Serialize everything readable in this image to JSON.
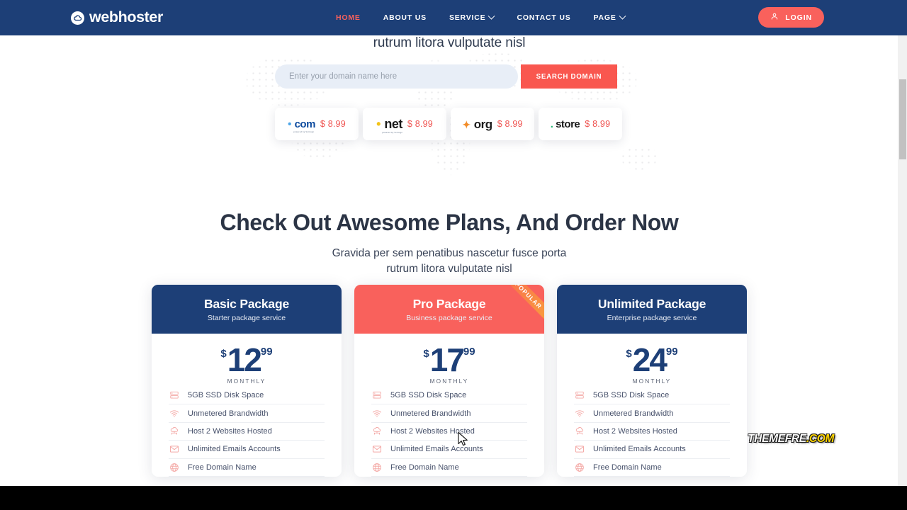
{
  "header": {
    "brand": "webhoster",
    "brand_icon": "cloud-icon",
    "nav": [
      {
        "label": "HOME",
        "active": true,
        "caret": false
      },
      {
        "label": "ABOUT US",
        "active": false,
        "caret": false
      },
      {
        "label": "SERVICE",
        "active": false,
        "caret": true
      },
      {
        "label": "CONTACT US",
        "active": false,
        "caret": false
      },
      {
        "label": "PAGE",
        "active": false,
        "caret": true
      }
    ],
    "login_label": "LOGIN",
    "login_icon": "user-icon",
    "bg_color": "#1d3f77",
    "accent_color": "#f9615c"
  },
  "hero": {
    "subtitle": "rutrum litora vulputate nisl",
    "search": {
      "placeholder": "Enter your domain name here",
      "value": "",
      "button_label": "SEARCH DOMAIN",
      "button_color": "#f9574f"
    },
    "tlds": [
      {
        "name": ".com",
        "logo_text": "com",
        "sub": "powered by Verisign",
        "price": "$ 8.99"
      },
      {
        "name": ".net",
        "logo_text": "net",
        "sub": "powered by Verisign",
        "price": "$ 8.99"
      },
      {
        "name": ".org",
        "logo_text": "org",
        "sub": "",
        "price": "$ 8.99"
      },
      {
        "name": ".store",
        "logo_text": "store",
        "sub": "",
        "price": "$ 8.99"
      }
    ]
  },
  "plans": {
    "title": "Check Out Awesome Plans, And Order Now",
    "subtitle": "Gravida per sem penatibus nascetur fusce porta\nrutrum litora vulputate nisl",
    "period_label": "MONTHLY",
    "currency": "$",
    "popular_label": "POPULAR",
    "cards": [
      {
        "name": "Basic Package",
        "tagline": "Starter package service",
        "theme": "navy",
        "popular": false,
        "amount": "12",
        "cents": "99",
        "features": [
          {
            "icon": "server-icon",
            "label": "5GB SSD Disk Space"
          },
          {
            "icon": "wifi-icon",
            "label": "Unmetered Brandwidth"
          },
          {
            "icon": "cloud-network-icon",
            "label": "Host 2 Websites Hosted"
          },
          {
            "icon": "envelope-icon",
            "label": "Unlimited Emails Accounts"
          },
          {
            "icon": "globe-icon",
            "label": "Free Domain Name"
          }
        ]
      },
      {
        "name": "Pro Package",
        "tagline": "Business package service",
        "theme": "coral",
        "popular": true,
        "amount": "17",
        "cents": "99",
        "features": [
          {
            "icon": "server-icon",
            "label": "5GB SSD Disk Space"
          },
          {
            "icon": "wifi-icon",
            "label": "Unmetered Brandwidth"
          },
          {
            "icon": "cloud-network-icon",
            "label": "Host 2 Websites Hosted"
          },
          {
            "icon": "envelope-icon",
            "label": "Unlimited Emails Accounts"
          },
          {
            "icon": "globe-icon",
            "label": "Free Domain Name"
          }
        ]
      },
      {
        "name": "Unlimited Package",
        "tagline": "Enterprise package service",
        "theme": "navy",
        "popular": false,
        "amount": "24",
        "cents": "99",
        "features": [
          {
            "icon": "server-icon",
            "label": "5GB SSD Disk Space"
          },
          {
            "icon": "wifi-icon",
            "label": "Unmetered Brandwidth"
          },
          {
            "icon": "cloud-network-icon",
            "label": "Host 2 Websites Hosted"
          },
          {
            "icon": "envelope-icon",
            "label": "Unlimited Emails Accounts"
          },
          {
            "icon": "globe-icon",
            "label": "Free Domain Name"
          }
        ]
      }
    ]
  },
  "watermark": {
    "part1": "THEMEFRE",
    "part2": ".COM"
  }
}
